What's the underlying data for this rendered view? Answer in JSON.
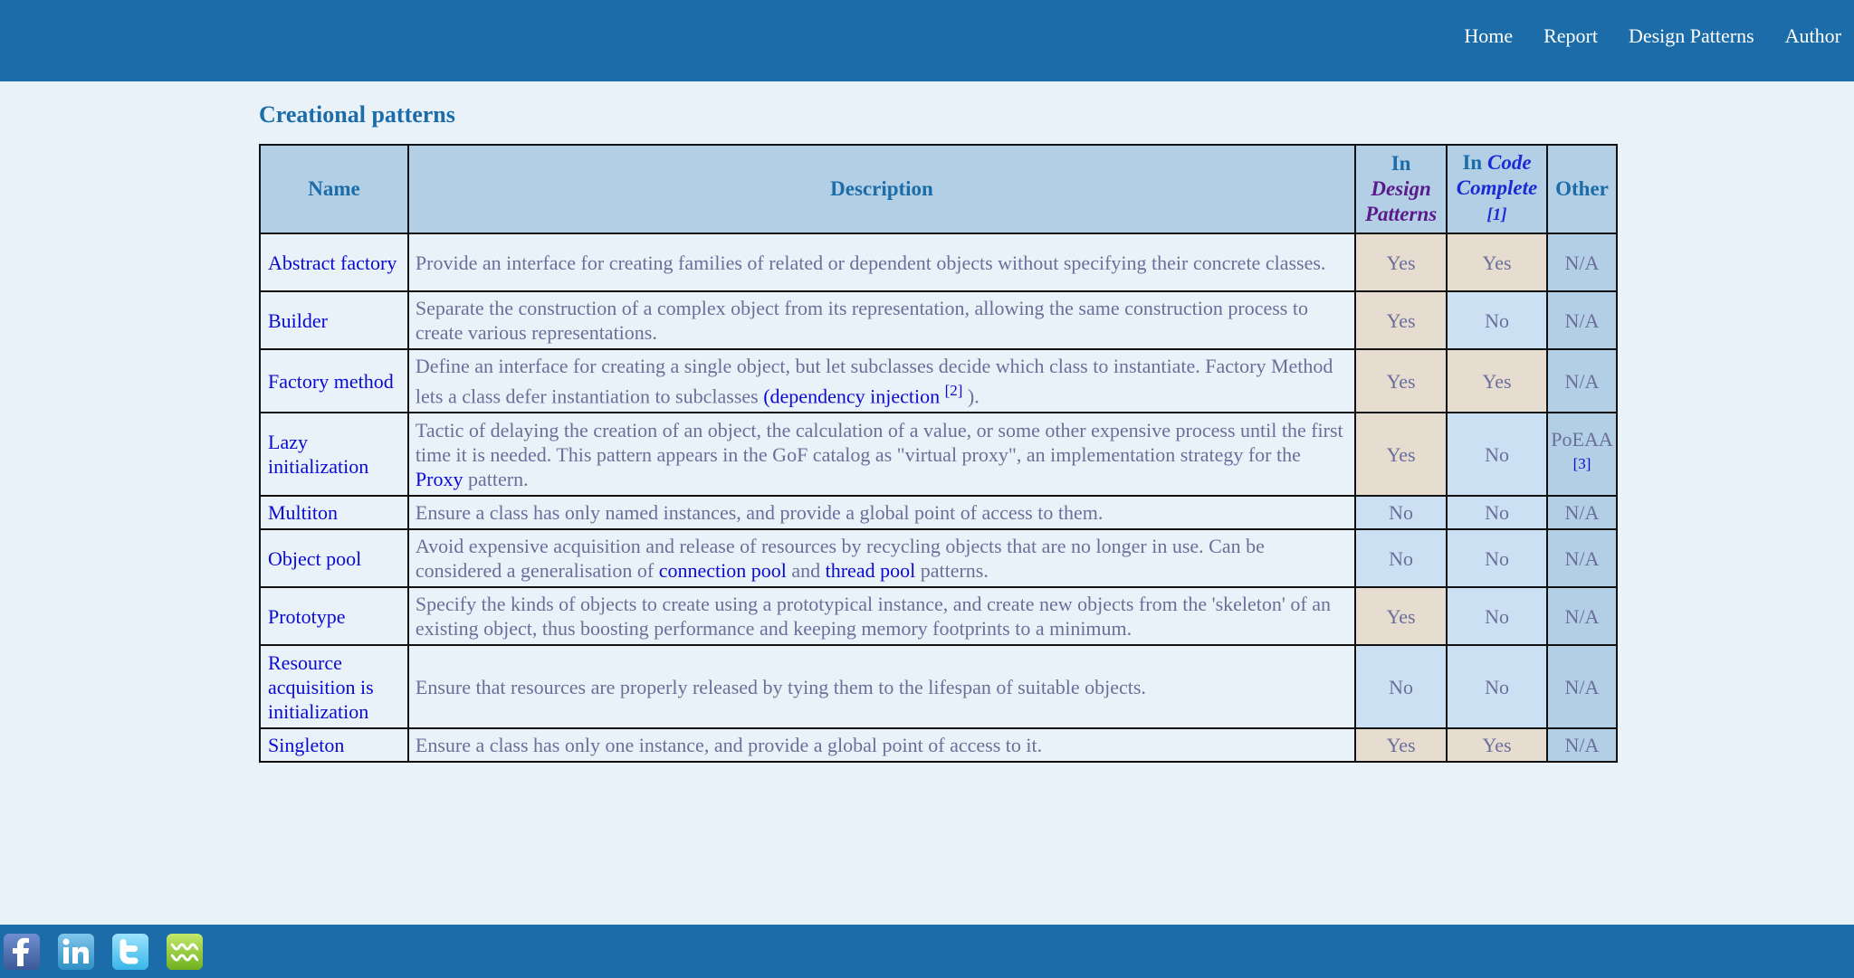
{
  "nav": {
    "items": [
      "Home",
      "Report",
      "Design Patterns",
      "Author"
    ]
  },
  "section": {
    "title": "Creational patterns"
  },
  "table": {
    "headers": {
      "name": "Name",
      "description": "Description",
      "dp_in": "In",
      "dp_title_1": "Design",
      "dp_title_2": "Patterns",
      "cc_in": "In",
      "cc_title_1": "Code",
      "cc_title_2": "Complete",
      "cc_ref": "[1]",
      "other": "Other"
    },
    "rows": [
      {
        "name": "Abstract factory",
        "desc": [
          {
            "t": "Provide an interface for creating families of related or dependent objects without specifying their concrete classes."
          }
        ],
        "dp": "Yes",
        "cc": "Yes",
        "other": "N/A",
        "other_ref": ""
      },
      {
        "name": "Builder",
        "desc": [
          {
            "t": "Separate the construction of a complex object from its representation, allowing the same construction process to create various representations."
          }
        ],
        "dp": "Yes",
        "cc": "No",
        "other": "N/A",
        "other_ref": ""
      },
      {
        "name": "Factory method",
        "desc": [
          {
            "t": "Define an interface for creating a single object, but let subclasses decide which class to instantiate. Factory Method lets a class defer instantiation to subclasses "
          },
          {
            "t": "(dependency injection",
            "link": true
          },
          {
            "t": " "
          },
          {
            "t": "[2]",
            "sup": true
          },
          {
            "t": " )."
          }
        ],
        "dp": "Yes",
        "cc": "Yes",
        "other": "N/A",
        "other_ref": ""
      },
      {
        "name": "Lazy initialization",
        "desc": [
          {
            "t": "Tactic of delaying the creation of an object, the calculation of a value, or some other expensive process until the first time it is needed. This pattern appears in the GoF catalog as \"virtual proxy\", an implementation strategy for the "
          },
          {
            "t": "Proxy",
            "link": true
          },
          {
            "t": " pattern."
          }
        ],
        "dp": "Yes",
        "cc": "No",
        "other": "PoEAA",
        "other_ref": "[3]"
      },
      {
        "name": "Multiton",
        "desc": [
          {
            "t": "Ensure a class has only named instances, and provide a global point of access to them."
          }
        ],
        "dp": "No",
        "cc": "No",
        "other": "N/A",
        "other_ref": ""
      },
      {
        "name": "Object pool",
        "desc": [
          {
            "t": "Avoid expensive acquisition and release of resources by recycling objects that are no longer in use. Can be considered a generalisation of "
          },
          {
            "t": "connection pool",
            "link": true
          },
          {
            "t": " and "
          },
          {
            "t": "thread pool",
            "link": true
          },
          {
            "t": " patterns."
          }
        ],
        "dp": "No",
        "cc": "No",
        "other": "N/A",
        "other_ref": ""
      },
      {
        "name": "Prototype",
        "desc": [
          {
            "t": "Specify the kinds of objects to create using a prototypical instance, and create new objects from the 'skeleton' of an existing object, thus boosting performance and keeping memory footprints to a minimum."
          }
        ],
        "dp": "Yes",
        "cc": "No",
        "other": "N/A",
        "other_ref": ""
      },
      {
        "name": "Resource acquisition is initialization",
        "desc": [
          {
            "t": "Ensure that resources are properly released by tying them to the lifespan of suitable objects."
          }
        ],
        "dp": "No",
        "cc": "No",
        "other": "N/A",
        "other_ref": ""
      },
      {
        "name": "Singleton",
        "desc": [
          {
            "t": "Ensure a class has only one instance, and provide a global point of access to it."
          }
        ],
        "dp": "Yes",
        "cc": "Yes",
        "other": "N/A",
        "other_ref": ""
      }
    ]
  },
  "footer": {
    "social": [
      "facebook-icon",
      "linkedin-icon",
      "twitter-icon",
      "wg-icon"
    ]
  },
  "colors": {
    "header_bar": "#1b6ca8",
    "page_bg": "#eaf2f9",
    "yes_cell": "#e6ddd0",
    "no_cell": "#cce0f3",
    "th_bg": "#b3cfe5",
    "link": "#0a0ad0"
  }
}
